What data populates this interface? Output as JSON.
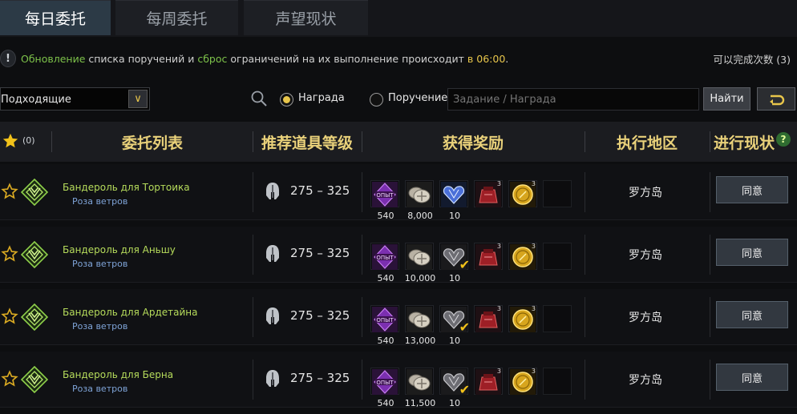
{
  "tabs": [
    {
      "label": "每日委托",
      "active": true
    },
    {
      "label": "每周委托",
      "active": false
    },
    {
      "label": "声望现状",
      "active": false
    }
  ],
  "notice": {
    "part1": "Обновление",
    "part2": " списка поручений и ",
    "part3": "сброс",
    "part4": " ограничений на их выполнение происходит ",
    "part5": "в 06:00",
    "part6": ".",
    "count": "可以完成次数 (3)"
  },
  "filter": {
    "select_value": "Подходящие",
    "radio_reward": "Награда",
    "radio_task": "Поручение",
    "search_placeholder": "Задание / Награда",
    "find_label": "Найти"
  },
  "header": {
    "star_count": "(0)",
    "col_list": "委托列表",
    "col_level": "推荐道具等级",
    "col_rewards": "获得奖励",
    "col_area": "执行地区",
    "col_status": "进行现状"
  },
  "rows": [
    {
      "title": "Бандероль для Тортоика",
      "region": "Роза ветров",
      "level": "275 – 325",
      "rewards": [
        {
          "icon": "exp-crystal-icon",
          "qty": "540"
        },
        {
          "icon": "silver-coins-icon",
          "qty": "8,000"
        },
        {
          "icon": "blue-heart-gem-icon",
          "qty": "10"
        },
        {
          "icon": "red-pouch-icon",
          "sup": "3"
        },
        {
          "icon": "gold-coin-icon",
          "sup": "3"
        }
      ],
      "place": "罗方岛",
      "accept": "同意"
    },
    {
      "title": "Бандероль для Аньшу",
      "region": "Роза ветров",
      "level": "275 – 325",
      "rewards": [
        {
          "icon": "exp-crystal-icon",
          "qty": "540"
        },
        {
          "icon": "silver-coins-icon",
          "qty": "10,000"
        },
        {
          "icon": "grey-heart-gem-icon",
          "qty": "10"
        },
        {
          "icon": "red-pouch-icon",
          "sup": "3"
        },
        {
          "icon": "gold-coin-icon",
          "sup": "3"
        }
      ],
      "place": "罗方岛",
      "accept": "同意"
    },
    {
      "title": "Бандероль для Ардетайна",
      "region": "Роза ветров",
      "level": "275 – 325",
      "rewards": [
        {
          "icon": "exp-crystal-icon",
          "qty": "540"
        },
        {
          "icon": "silver-coins-icon",
          "qty": "13,000"
        },
        {
          "icon": "grey-heart-gem-icon",
          "qty": "10"
        },
        {
          "icon": "red-pouch-icon",
          "sup": "3"
        },
        {
          "icon": "gold-coin-icon",
          "sup": "3"
        }
      ],
      "place": "罗方岛",
      "accept": "同意"
    },
    {
      "title": "Бандероль для Берна",
      "region": "Роза ветров",
      "level": "275 – 325",
      "rewards": [
        {
          "icon": "exp-crystal-icon",
          "qty": "540"
        },
        {
          "icon": "silver-coins-icon",
          "qty": "11,500"
        },
        {
          "icon": "grey-heart-gem-icon",
          "qty": "10"
        },
        {
          "icon": "red-pouch-icon",
          "sup": "3"
        },
        {
          "icon": "gold-coin-icon",
          "sup": "3"
        }
      ],
      "place": "罗方岛",
      "accept": "同意"
    }
  ],
  "colors": {
    "accent_yellow": "#e8c64b",
    "title_green": "#b6dc5b",
    "region_blue": "#7fa4d8",
    "tab_active": "#2c3a46"
  }
}
